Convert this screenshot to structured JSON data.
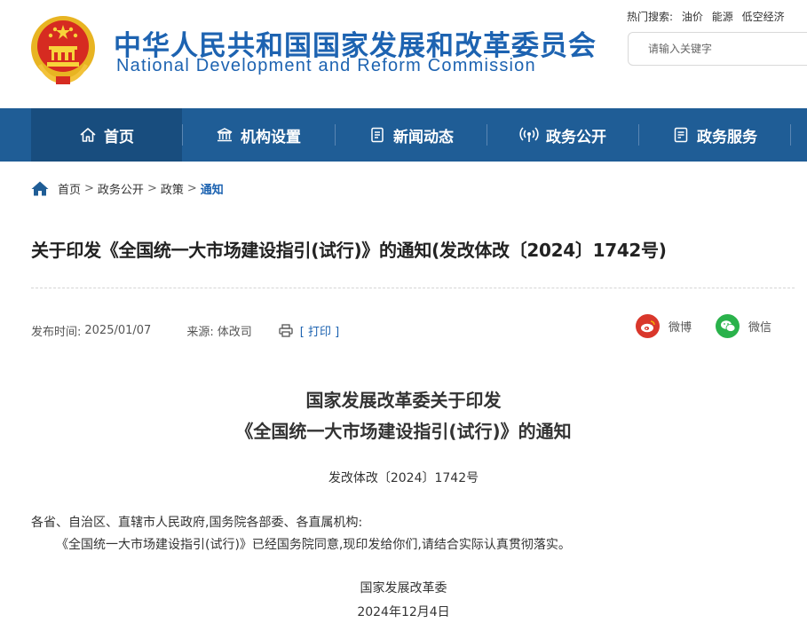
{
  "site": {
    "name_cn": "中华人民共和国国家发展和改革委员会",
    "name_en": "National Development and Reform Commission"
  },
  "hot_search": {
    "label": "热门搜索:",
    "keywords": [
      "油价",
      "能源",
      "低空经济"
    ]
  },
  "search": {
    "placeholder": "请输入关键字"
  },
  "nav": {
    "items": [
      {
        "label": "首页",
        "icon": "home-icon"
      },
      {
        "label": "机构设置",
        "icon": "building-icon"
      },
      {
        "label": "新闻动态",
        "icon": "news-icon"
      },
      {
        "label": "政务公开",
        "icon": "broadcast-icon"
      },
      {
        "label": "政务服务",
        "icon": "service-icon"
      }
    ]
  },
  "breadcrumb": [
    "首页",
    "政务公开",
    "政策",
    "通知"
  ],
  "article": {
    "headline": "关于印发《全国统一大市场建设指引(试行)》的通知(发改体改〔2024〕1742号)",
    "publish_label": "发布时间:",
    "publish_date": "2025/01/07",
    "source_label": "来源:",
    "source": "体改司",
    "print_label": "[ 打印 ]",
    "share": {
      "weibo": "微博",
      "wechat": "微信"
    },
    "title_line1": "国家发展改革委关于印发",
    "title_line2": "《全国统一大市场建设指引(试行)》的通知",
    "doc_number": "发改体改〔2024〕1742号",
    "addressee": "各省、自治区、直辖市人民政府,国务院各部委、各直属机构:",
    "body": "《全国统一大市场建设指引(试行)》已经国务院同意,现印发给你们,请结合实际认真贯彻落实。",
    "signature": "国家发展改革委",
    "date": "2024年12月4日"
  },
  "colors": {
    "brand_blue": "#1d63b1",
    "nav_bg": "#1f5d96",
    "nav_active": "#184d7e",
    "weibo_red": "#d9372b",
    "wechat_green": "#2ab24b"
  }
}
